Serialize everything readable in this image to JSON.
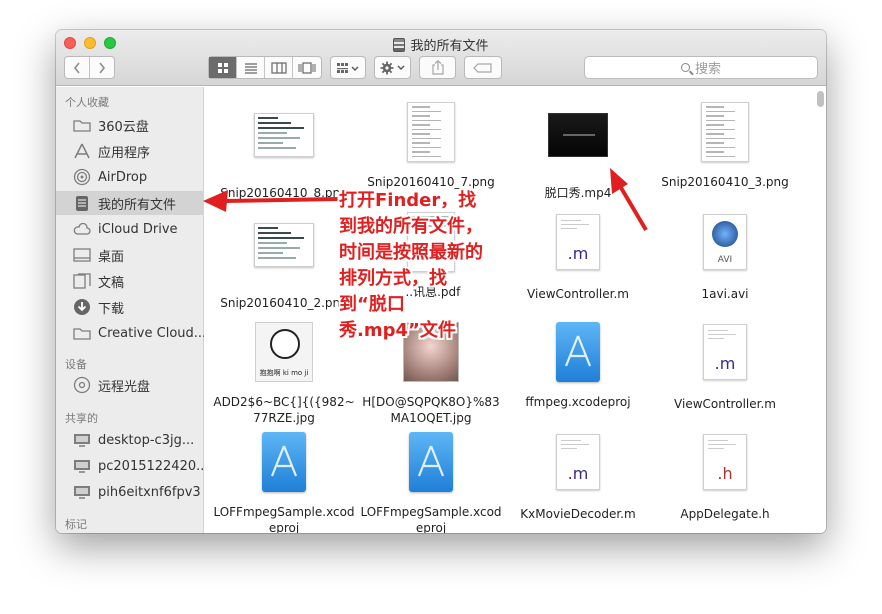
{
  "window": {
    "title": "我的所有文件"
  },
  "toolbar": {
    "back_icon": "chevron-left-icon",
    "forward_icon": "chevron-right-icon",
    "view_modes": [
      "icon-view",
      "list-view",
      "column-view",
      "cover-flow-view"
    ],
    "active_view": "icon-view",
    "arrange_icon": "arrange-icon",
    "action_icon": "gear-icon",
    "share_icon": "share-icon",
    "tag_icon": "tag-icon",
    "search_placeholder": "搜索"
  },
  "sidebar": {
    "favorites_label": "个人收藏",
    "favorites": [
      {
        "label": "360云盘",
        "icon": "folder-icon"
      },
      {
        "label": "应用程序",
        "icon": "applications-icon"
      },
      {
        "label": "AirDrop",
        "icon": "airdrop-icon"
      },
      {
        "label": "我的所有文件",
        "icon": "all-files-icon",
        "selected": true
      },
      {
        "label": "iCloud Drive",
        "icon": "cloud-icon"
      },
      {
        "label": "桌面",
        "icon": "desktop-icon"
      },
      {
        "label": "文稿",
        "icon": "documents-icon"
      },
      {
        "label": "下载",
        "icon": "download-icon"
      },
      {
        "label": "Creative Cloud...",
        "icon": "folder-icon"
      }
    ],
    "devices_label": "设备",
    "devices": [
      {
        "label": "远程光盘",
        "icon": "disc-icon"
      }
    ],
    "shared_label": "共享的",
    "shared": [
      {
        "label": "desktop-c3jg...",
        "icon": "computer-icon"
      },
      {
        "label": "pc2015122420...",
        "icon": "computer-icon"
      },
      {
        "label": "pih6eitxnf6fpv3",
        "icon": "computer-icon"
      }
    ],
    "tags_label": "标记"
  },
  "files": [
    {
      "name": "Snip20160410_8.png",
      "kind": "screenshot"
    },
    {
      "name": "Snip20160410_7.png",
      "kind": "document-scan"
    },
    {
      "name": "脱口秀.mp4",
      "kind": "video"
    },
    {
      "name": "Snip20160410_3.png",
      "kind": "document-scan"
    },
    {
      "name": "Snip20160410_2.png",
      "kind": "screenshot"
    },
    {
      "name": "...讯息.pdf",
      "kind": "pdf"
    },
    {
      "name": "ViewController.m",
      "kind": "code",
      "ext": ".m"
    },
    {
      "name": "1avi.avi",
      "kind": "avi",
      "badge": "AVI"
    },
    {
      "name": "ADD2$6~BC{]{({982~77RZE.jpg",
      "kind": "meme",
      "caption": "抱抱啊 ki mo ji"
    },
    {
      "name": "H[DO@SQPQK8O}%83MA1OQET.jpg",
      "kind": "photo"
    },
    {
      "name": "ffmpeg.xcodeproj",
      "kind": "xcodeproj"
    },
    {
      "name": "ViewController.m",
      "kind": "code",
      "ext": ".m"
    },
    {
      "name": "LOFFmpegSample.xcodeproj",
      "kind": "xcodeproj"
    },
    {
      "name": "LOFFmpegSample.xcodeproj",
      "kind": "xcodeproj"
    },
    {
      "name": "KxMovieDecoder.m",
      "kind": "code",
      "ext": ".m"
    },
    {
      "name": "AppDelegate.h",
      "kind": "code",
      "ext": ".h"
    }
  ],
  "annotation": {
    "text": "打开Finder，找到我的所有文件，时间是按照最新的排列方式，找到“脱口秀.mp4”文件",
    "color": "#e02020"
  },
  "colors": {
    "accent_red": "#e02020",
    "sidebar_bg": "#ececec",
    "selected_bg": "#d3d3d3"
  }
}
